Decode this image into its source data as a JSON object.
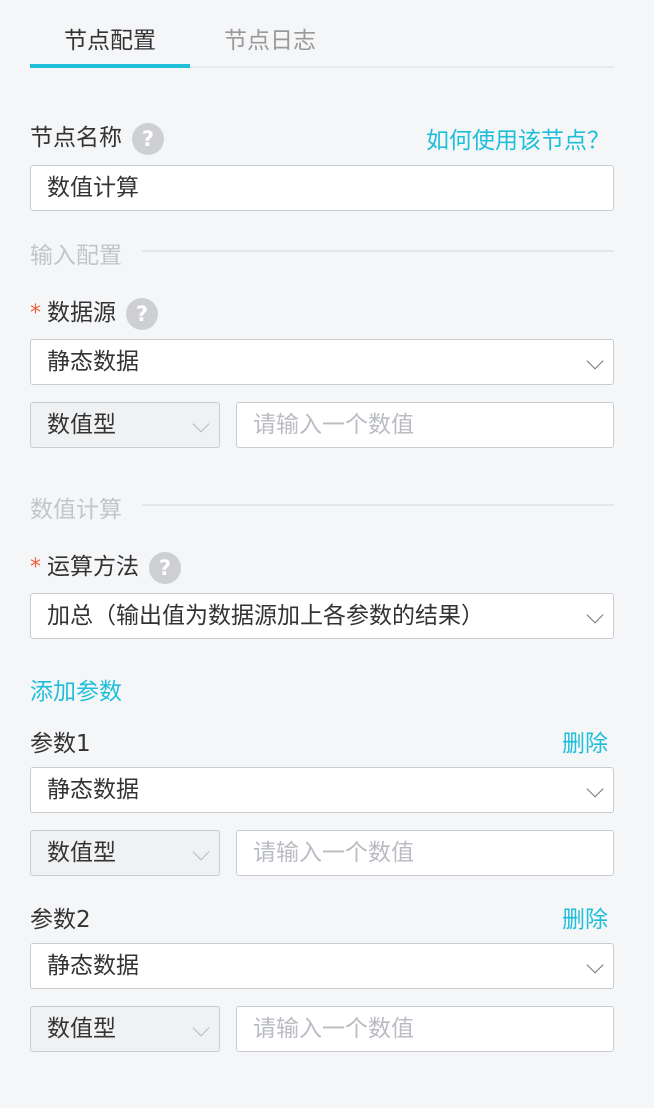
{
  "tabs": [
    {
      "label": "节点配置",
      "active": true
    },
    {
      "label": "节点日志",
      "active": false
    }
  ],
  "node_name": {
    "label": "节点名称",
    "help_icon": "question-icon",
    "help_link": "如何使用该节点？",
    "value": "数值计算"
  },
  "input_section": {
    "title": "输入配置",
    "datasource": {
      "required_mark": "*",
      "label": "数据源",
      "selected": "静态数据",
      "type_selected": "数值型",
      "value_placeholder": "请输入一个数值"
    }
  },
  "calc_section": {
    "title": "数值计算",
    "method": {
      "required_mark": "*",
      "label": "运算方法",
      "selected": "加总（输出值为数据源加上各参数的结果）"
    },
    "add_param_label": "添加参数",
    "params": [
      {
        "label": "参数1",
        "delete_label": "删除",
        "source": "静态数据",
        "type": "数值型",
        "placeholder": "请输入一个数值"
      },
      {
        "label": "参数2",
        "delete_label": "删除",
        "source": "静态数据",
        "type": "数值型",
        "placeholder": "请输入一个数值"
      }
    ]
  },
  "colors": {
    "accent": "#1fbfd9",
    "required": "#f5603f",
    "background": "#f5f6f8"
  }
}
